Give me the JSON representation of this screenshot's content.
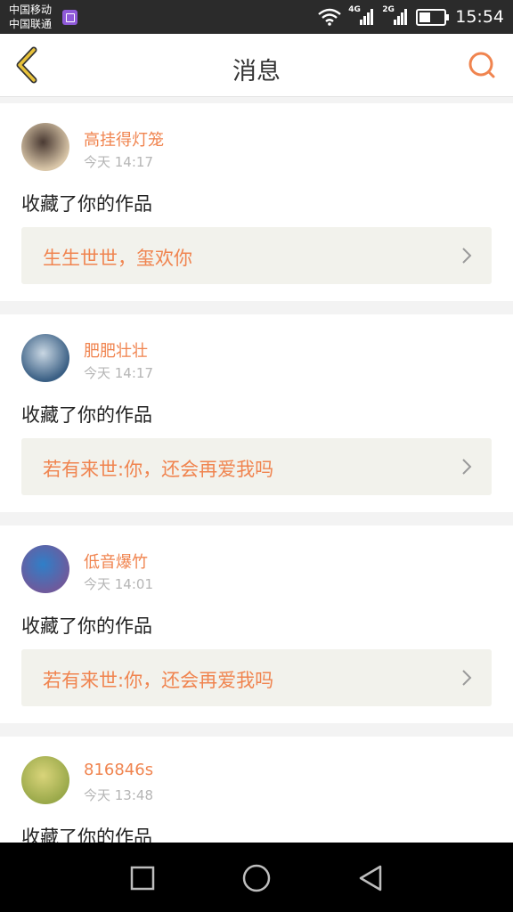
{
  "status_bar": {
    "carrier_1": "中国移动",
    "carrier_2": "中国联通",
    "network_1": "4G",
    "network_2": "2G",
    "time": "15:54",
    "battery_level": 0.45
  },
  "header": {
    "title": "消息",
    "back_icon": "chevron-left-icon",
    "search_icon": "search-icon"
  },
  "colors": {
    "accent": "#f0844f",
    "header_icon": "#e8c23a"
  },
  "messages": [
    {
      "username": "高挂得灯笼",
      "time": "今天 14:17",
      "action": "收藏了你的作品",
      "work_title": "生生世世，玺欢你",
      "avatar_colors": [
        "#d9c6a8",
        "#4a3a33"
      ]
    },
    {
      "username": "肥肥壮壮",
      "time": "今天 14:17",
      "action": "收藏了你的作品",
      "work_title": "若有来世:你，还会再爱我吗",
      "avatar_colors": [
        "#3a5f84",
        "#c9d7e3"
      ]
    },
    {
      "username": "低音爆竹",
      "time": "今天 14:01",
      "action": "收藏了你的作品",
      "work_title": "若有来世:你，还会再爱我吗",
      "avatar_colors": [
        "#6e5a9c",
        "#2f7fc8"
      ]
    },
    {
      "username": "816846s",
      "time": "今天 13:48",
      "action": "收藏了你的作品",
      "work_title": "",
      "avatar_colors": [
        "#9aa94a",
        "#d9d47a"
      ]
    }
  ],
  "nav_bar": {
    "recent_icon": "square-icon",
    "home_icon": "circle-icon",
    "back_icon": "triangle-back-icon"
  }
}
